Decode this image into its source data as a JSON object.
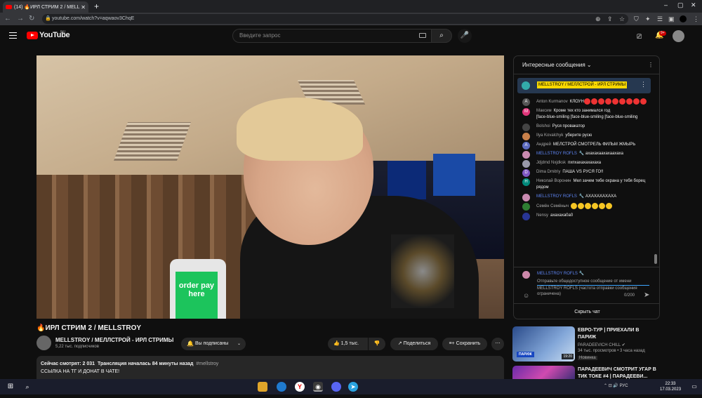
{
  "browser": {
    "tab_title": "(14) 🔥ИРЛ СТРИМ 2 / MELL",
    "url": "youtube.com/watch?v=aqwaov3ChqE"
  },
  "youtube": {
    "logo_text": "YouTube",
    "region_badge": "RU",
    "search_placeholder": "Введите запрос",
    "notification_count": "9+"
  },
  "video": {
    "title": "🔥ИРЛ СТРИМ 2 / MELLSTROY",
    "kiosk_text": "order pay here",
    "channel_name": "MELLSTROY / МЕЛЛСТРОЙ - ИРЛ СТРИМЫ",
    "subscribers": "5,22 тыс. подписчиков",
    "subscribe_label": "Вы подписаны",
    "likes": "1,5 тыс.",
    "share_label": "Поделиться",
    "save_label": "Сохранить",
    "watching_now": "Сейчас смотрят: 2 031",
    "started": "Трансляция началась 84 минуты назад",
    "hashtag": "#mellstroy",
    "description": "ССЫЛКА НА ТГ И ДОНАТ В ЧАТЕ!"
  },
  "chat": {
    "mode_label": "Интересные сообщения",
    "pinned_author": "MELLSTROY / МЕЛЛСТРОЙ - ИРЛ СТРИМЫ",
    "messages": [
      {
        "author": "Anton Kurmanov",
        "text": "КЛОУН",
        "initial": "A",
        "color": "#555555"
      },
      {
        "author": "Максим",
        "text": "Кроме тех кто занимался год",
        "extra": "[face-blue-smiling [face-blue-smiling [face-blue-smiling",
        "initial": "M",
        "color": "#e0357a"
      },
      {
        "author": "Bolshoi",
        "text": "Руся провакатор",
        "initial": "",
        "color": "#444444"
      },
      {
        "author": "Ilya Kovalchyk",
        "text": "уберите русю",
        "initial": "",
        "color": "#c8804a"
      },
      {
        "author": "Андрей",
        "text": "МЕЛСТРОЙ СМОТРЕЛЬ ФИЛЬМ ЖМЫРЬ",
        "initial": "A",
        "color": "#5c6bc0"
      },
      {
        "author": "MELLSTROY ROFLS",
        "text": "ахахахаахахаахаха",
        "initial": "",
        "color": "#c98ab0",
        "mod": true
      },
      {
        "author": "Jdjdmd Nxjdksk",
        "text": "пхпхахахахахаха",
        "initial": "",
        "color": "#9999aa"
      },
      {
        "author": "Dima Dmitriy",
        "text": "ПАША VS РУСЯ ГО!!",
        "initial": "D",
        "color": "#7e57c2"
      },
      {
        "author": "Николай Воронин",
        "text": "Мел зачем тебе охрана у тебя борец рядом",
        "initial": "Н",
        "color": "#00897b"
      },
      {
        "author": "MELLSTROY ROFLS",
        "text": "АХАХАХАХАХА",
        "initial": "",
        "color": "#c98ab0",
        "mod": true
      },
      {
        "author": "Семён Семёныч",
        "text": "",
        "initial": "",
        "color": "#2e7d32"
      },
      {
        "author": "Nensy",
        "text": "ахахаха0а0",
        "initial": "",
        "color": "#283593"
      }
    ],
    "composer_author": "MELLSTROY ROFLS",
    "composer_placeholder": "Отправьте общедоступное сообщение от имени",
    "composer_note": "MELLSTROY ROFLS (частота отправки сообщения ограничена)",
    "char_count": "0/200",
    "hide_chat_label": "Скрыть чат"
  },
  "recommendations": [
    {
      "title": "ЕВРО-ТУР | ПРИЕХАЛИ В ПАРИЖ",
      "channel": "PARADEEVICH CHILL",
      "views": "34 тыс. просмотров",
      "ago": "3 часа назад",
      "badge": "Новинка",
      "thumb_label": "ПАРИЖ",
      "duration": "19:20"
    },
    {
      "title": "ПАРАДЕЕВИЧ СМОТРИТ УГАР В ТИК ТОКЕ #4 | ПАРАДЕЕВИ...",
      "channel": "",
      "views": "",
      "ago": "",
      "badge": "",
      "thumb_label": "",
      "duration": ""
    }
  ],
  "taskbar": {
    "language": "РУС",
    "time": "22:33",
    "date": "17.03.2023"
  }
}
